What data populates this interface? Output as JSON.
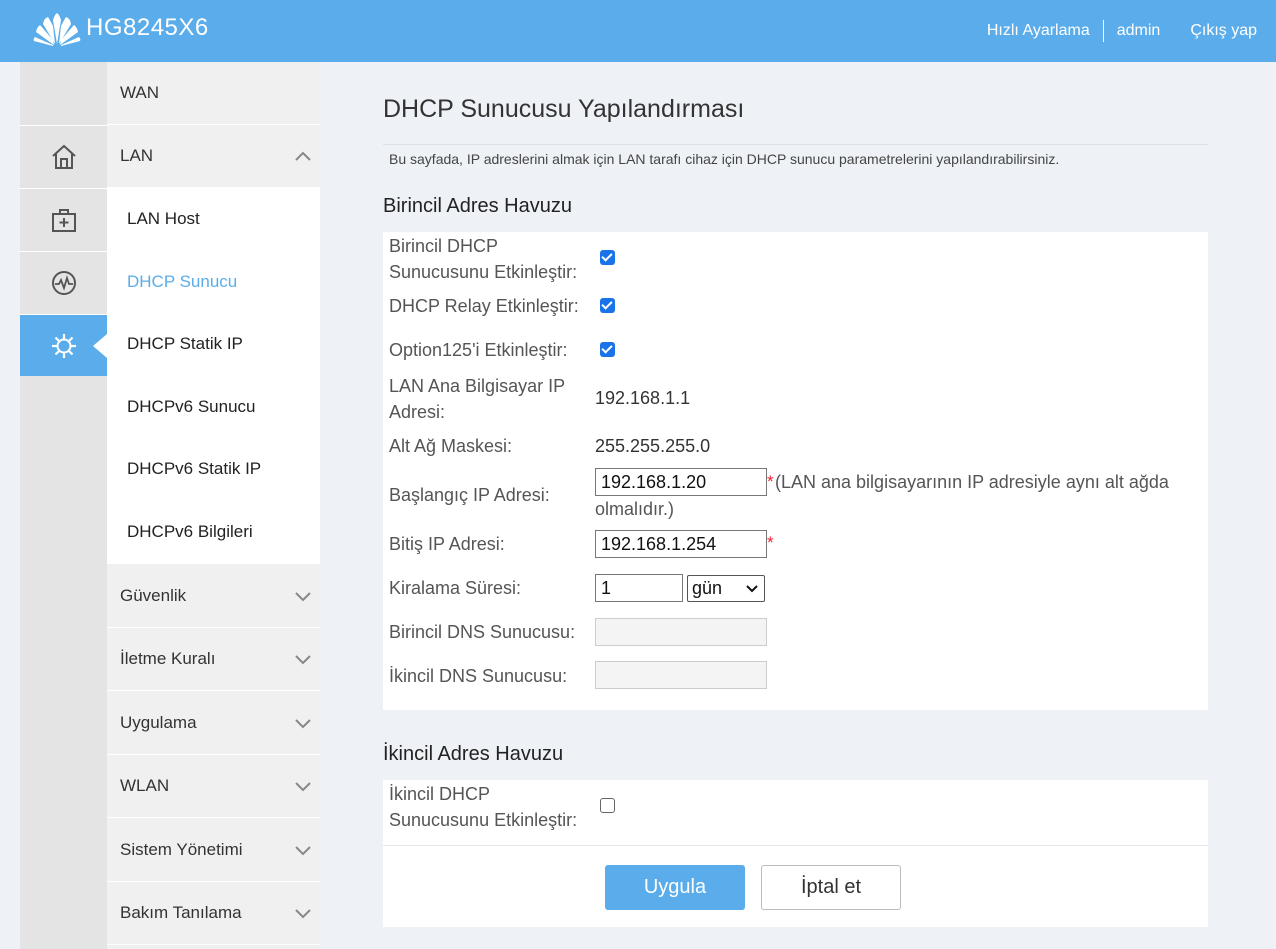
{
  "header": {
    "model": "HG8245X6",
    "links": [
      "Hızlı Ayarlama",
      "admin",
      "Çıkış yap"
    ]
  },
  "icons": [
    "home-icon",
    "toolbox-icon",
    "monitor-icon",
    "settings-icon"
  ],
  "menu": {
    "wan": "WAN",
    "lan": "LAN",
    "lan_sub": [
      "LAN Host",
      "DHCP Sunucu",
      "DHCP Statik IP",
      "DHCPv6 Sunucu",
      "DHCPv6 Statik IP",
      "DHCPv6 Bilgileri"
    ],
    "selected": "DHCP Sunucu",
    "collapsed": [
      "Güvenlik",
      "İletme Kuralı",
      "Uygulama",
      "WLAN",
      "Sistem Yönetimi",
      "Bakım Tanılama"
    ]
  },
  "page": {
    "title": "DHCP Sunucusu Yapılandırması",
    "description": "Bu sayfada, IP adreslerini almak için LAN tarafı cihaz için DHCP sunucu parametrelerini yapılandırabilirsiniz."
  },
  "primary_pool": {
    "heading": "Birincil Adres Havuzu",
    "enable_label_1": "Birincil DHCP",
    "enable_label_2": "Sunucusunu Etkinleştir:",
    "enable_checked": true,
    "relay_label": "DHCP Relay Etkinleştir:",
    "relay_checked": true,
    "option125_label": "Option125'i Etkinleştir:",
    "option125_checked": true,
    "lan_ip_label_1": "LAN Ana Bilgisayar IP",
    "lan_ip_label_2": "Adresi:",
    "lan_ip_value": "192.168.1.1",
    "mask_label": "Alt Ağ Maskesi:",
    "mask_value": "255.255.255.0",
    "start_label": "Başlangıç IP Adresi:",
    "start_value": "192.168.1.20",
    "start_hint_1": "(LAN ana bilgisayarının IP adresiyle aynı alt ağda",
    "start_hint_2": "olmalıdır.)",
    "end_label": "Bitiş IP Adresi:",
    "end_value": "192.168.1.254",
    "required_mark": "*",
    "lease_label": "Kiralama Süresi:",
    "lease_value": "1",
    "lease_unit": "gün",
    "dns1_label": "Birincil DNS Sunucusu:",
    "dns1_value": "",
    "dns2_label": "İkincil DNS Sunucusu:",
    "dns2_value": ""
  },
  "secondary_pool": {
    "heading": "İkincil Adres Havuzu",
    "enable_label_1": "İkincil DHCP",
    "enable_label_2": "Sunucusunu Etkinleştir:",
    "enable_checked": false
  },
  "buttons": {
    "apply": "Uygula",
    "cancel": "İptal et"
  }
}
